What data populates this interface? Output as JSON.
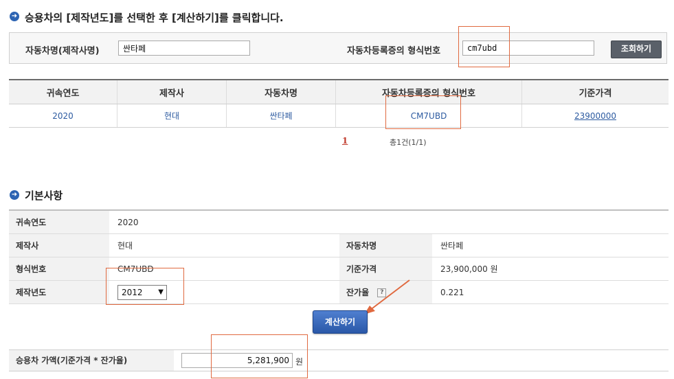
{
  "instruction": {
    "title": "승용차의 [제작년도]를 선택한 후 [계산하기]를 클릭합니다."
  },
  "search": {
    "model_label": "자동차명(제작사명)",
    "model_value": "싼타페",
    "type_label": "자동차등록증의 형식번호",
    "type_value": "cm7ubd",
    "search_button": "조회하기"
  },
  "results": {
    "headers": [
      "귀속연도",
      "제작사",
      "자동차명",
      "자동차등록증의 형식번호",
      "기준가격"
    ],
    "rows": [
      {
        "year": "2020",
        "maker": "현대",
        "model": "싼타페",
        "type_no": "CM7UBD",
        "price": "23900000"
      }
    ],
    "pagination": {
      "current_page": "1",
      "total_text": "총1건(1/1)"
    }
  },
  "basic_info": {
    "title": "기본사항",
    "year_label": "귀속연도",
    "year_value": "2020",
    "maker_label": "제작사",
    "maker_value": "현대",
    "model_label": "자동차명",
    "model_value": "싼타페",
    "type_label": "형식번호",
    "type_value": "CM7UBD",
    "price_label": "기준가격",
    "price_value": "23,900,000 원",
    "mfg_year_label": "제작년도",
    "mfg_year_selected": "2012",
    "residual_label": "잔가율",
    "residual_help": "?",
    "residual_value": "0.221"
  },
  "calc_button": "계산하기",
  "result": {
    "label": "승용차 가액(기준가격 * 잔가율)",
    "value": "5,281,900",
    "unit": "원"
  },
  "colors": {
    "accent_blue": "#2d64b3",
    "highlight_box": "#e0693f",
    "link_blue": "#2c5aa0",
    "page_red": "#c0392b"
  }
}
